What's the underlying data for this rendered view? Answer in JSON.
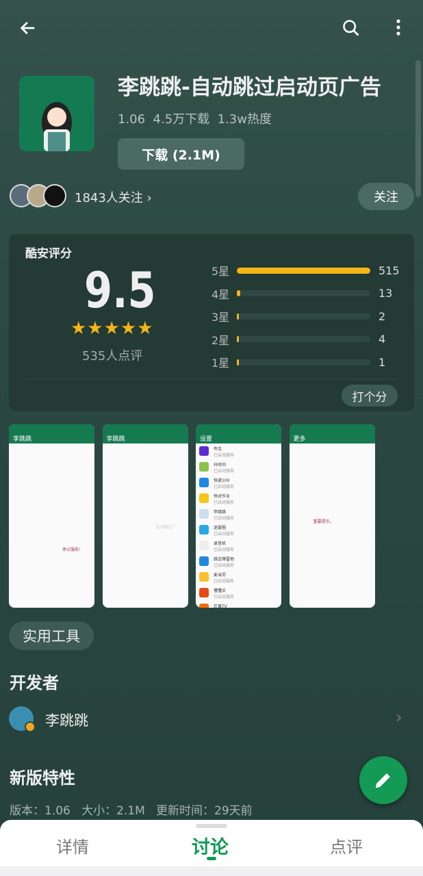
{
  "toolbar": {
    "back": "back-arrow-icon",
    "search": "search-icon",
    "more": "more-vert-icon"
  },
  "app": {
    "title": "李跳跳-自动跳过启动页广告",
    "version": "1.06",
    "downloads": "4.5万下载",
    "heat": "1.3w热度",
    "download_label": "下载 (2.1M)",
    "followers": "1843人关注",
    "follow_label": "关注"
  },
  "rating": {
    "heading": "酷安评分",
    "score": "9.5",
    "stars": 5,
    "count": "535人点评",
    "rate_label": "打个分",
    "rows": [
      {
        "label": "5星",
        "count": "515",
        "value": 515
      },
      {
        "label": "4星",
        "count": "13",
        "value": 13
      },
      {
        "label": "3星",
        "count": "2",
        "value": 2
      },
      {
        "label": "2星",
        "count": "4",
        "value": 4
      },
      {
        "label": "1星",
        "count": "1",
        "value": 1
      }
    ],
    "color": "#f5b418"
  },
  "screenshots": [
    {
      "title": "李跳跳",
      "text": "停止服务!"
    },
    {
      "title": "李跳跳",
      "text": "无法跳过?"
    },
    {
      "title": "设置",
      "items": [
        "夸克",
        "抖时间",
        "快递100",
        "快对作业",
        "李跳跳",
        "迷雾圈",
        "录音机",
        "跳话博雷他",
        "麦当劳",
        "懂懂买",
        "芒果TV"
      ],
      "sub": "已启动服务"
    },
    {
      "title": "更多",
      "text": "重要提示。"
    }
  ],
  "category": "实用工具",
  "developer": {
    "heading": "开发者",
    "name": "李跳跳"
  },
  "whatsnew": {
    "heading": "新版特性",
    "version": "版本：1.06",
    "size": "大小：2.1M",
    "updated": "更新时间：29天前"
  },
  "tabs": [
    {
      "label": "详情"
    },
    {
      "label": "讨论",
      "active": true
    },
    {
      "label": "点评"
    }
  ],
  "colors": {
    "accent": "#139a55",
    "star": "#f5b418"
  }
}
